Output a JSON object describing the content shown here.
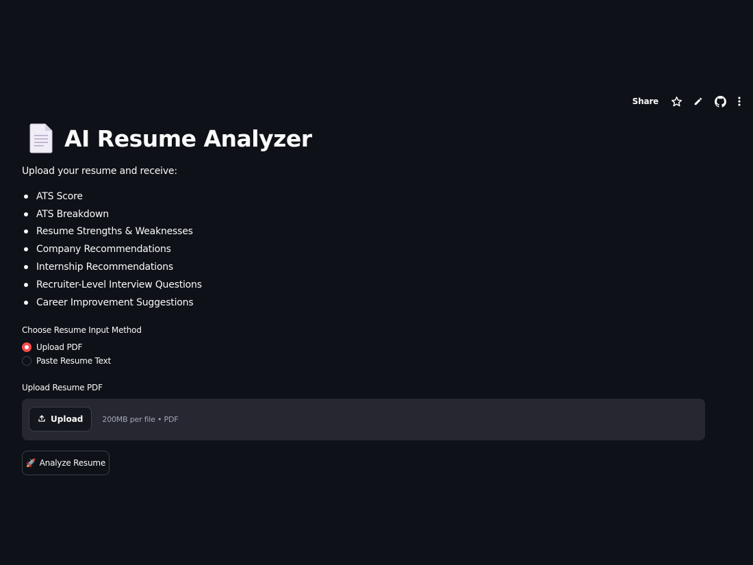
{
  "toolbar": {
    "share_label": "Share",
    "icons": [
      "star-icon",
      "pencil-icon",
      "github-icon",
      "more-vertical-icon"
    ]
  },
  "header": {
    "icon": "document-icon",
    "title": "AI Resume Analyzer"
  },
  "intro": "Upload your resume and receive:",
  "features": [
    "ATS Score",
    "ATS Breakdown",
    "Resume Strengths & Weaknesses",
    "Company Recommendations",
    "Internship Recommendations",
    "Recruiter-Level Interview Questions",
    "Career Improvement Suggestions"
  ],
  "input_method": {
    "label": "Choose Resume Input Method",
    "options": [
      {
        "label": "Upload PDF",
        "selected": true
      },
      {
        "label": "Paste Resume Text",
        "selected": false
      }
    ]
  },
  "uploader": {
    "label": "Upload Resume PDF",
    "button_label": "Upload",
    "limit_text": "200MB per file • PDF"
  },
  "analyze": {
    "emoji": "🚀",
    "label": "Analyze Resume"
  },
  "colors": {
    "background": "#0e1117",
    "accent": "#ff4b4b",
    "dropzone": "#262730",
    "text": "#fafafa"
  }
}
